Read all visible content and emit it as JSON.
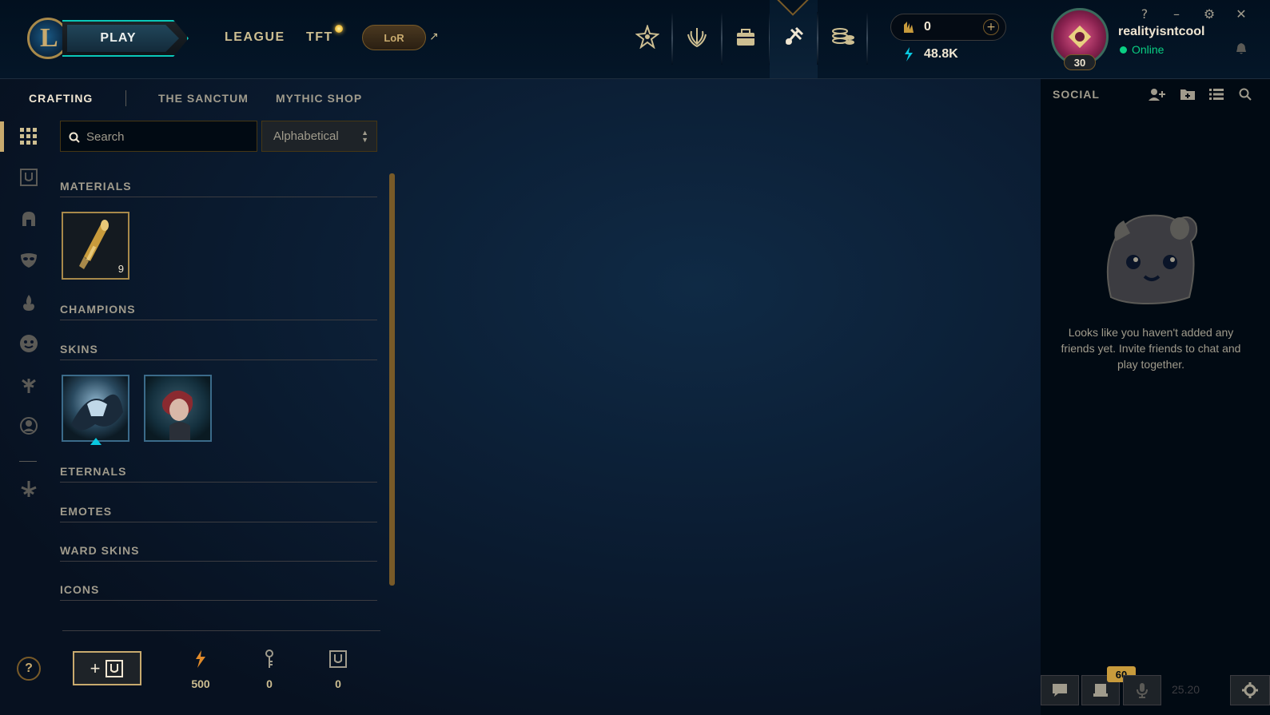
{
  "topbar": {
    "play_label": "PLAY",
    "nav": {
      "league": "LEAGUE",
      "tft": "TFT",
      "lor": "LoR"
    },
    "icons": [
      "ranked-icon",
      "store-icon",
      "collection-icon",
      "loot-icon",
      "currency-store-icon"
    ],
    "rp": "0",
    "blue_essence": "48.8K",
    "username": "realityisntcool",
    "status": "Online",
    "level": "30",
    "window_controls": [
      "?",
      "–",
      "⚙",
      "✕"
    ]
  },
  "subnav": {
    "crafting": "CRAFTING",
    "sanctum": "THE SANCTUM",
    "mythic_shop": "MYTHIC SHOP"
  },
  "toolbar": {
    "search_placeholder": "Search",
    "sort_value": "Alphabetical"
  },
  "categories": {
    "materials": "MATERIALS",
    "champions": "CHAMPIONS",
    "skins": "SKINS",
    "eternals": "ETERNALS",
    "emotes": "EMOTES",
    "ward_skins": "WARD SKINS",
    "icons": "ICONS"
  },
  "materials": {
    "key_count": "9"
  },
  "footer": {
    "add_chest_label": "+",
    "orange_essence": "500",
    "keys": "0",
    "chests": "0"
  },
  "social": {
    "title": "SOCIAL",
    "empty_message": "Looks like you haven't added any friends yet. Invite friends to chat and play together."
  },
  "bottom": {
    "badge": "60",
    "version": "25.20"
  },
  "colors": {
    "gold": "#c8aa6e",
    "teal": "#0ac8b9",
    "online": "#0acf83",
    "background": "#0a1428"
  }
}
